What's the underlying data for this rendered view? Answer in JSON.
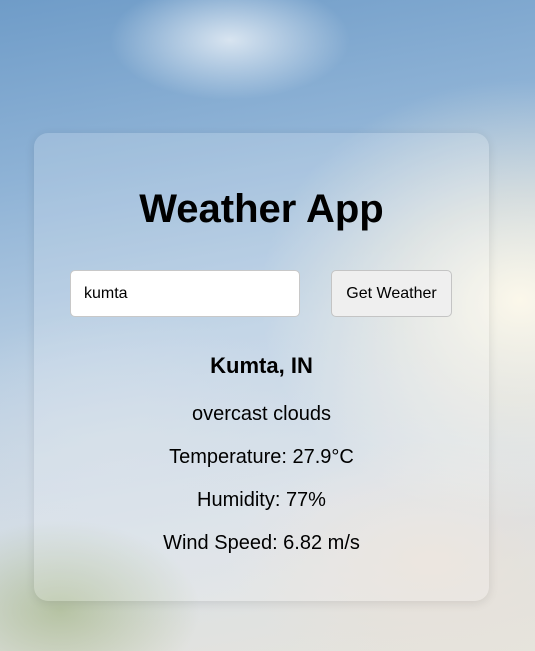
{
  "app": {
    "title": "Weather App"
  },
  "search": {
    "value": "kumta",
    "button_label": "Get Weather"
  },
  "result": {
    "location": "Kumta, IN",
    "description": "overcast clouds",
    "temperature": "Temperature: 27.9°C",
    "humidity": "Humidity: 77%",
    "wind": "Wind Speed: 6.82 m/s"
  }
}
